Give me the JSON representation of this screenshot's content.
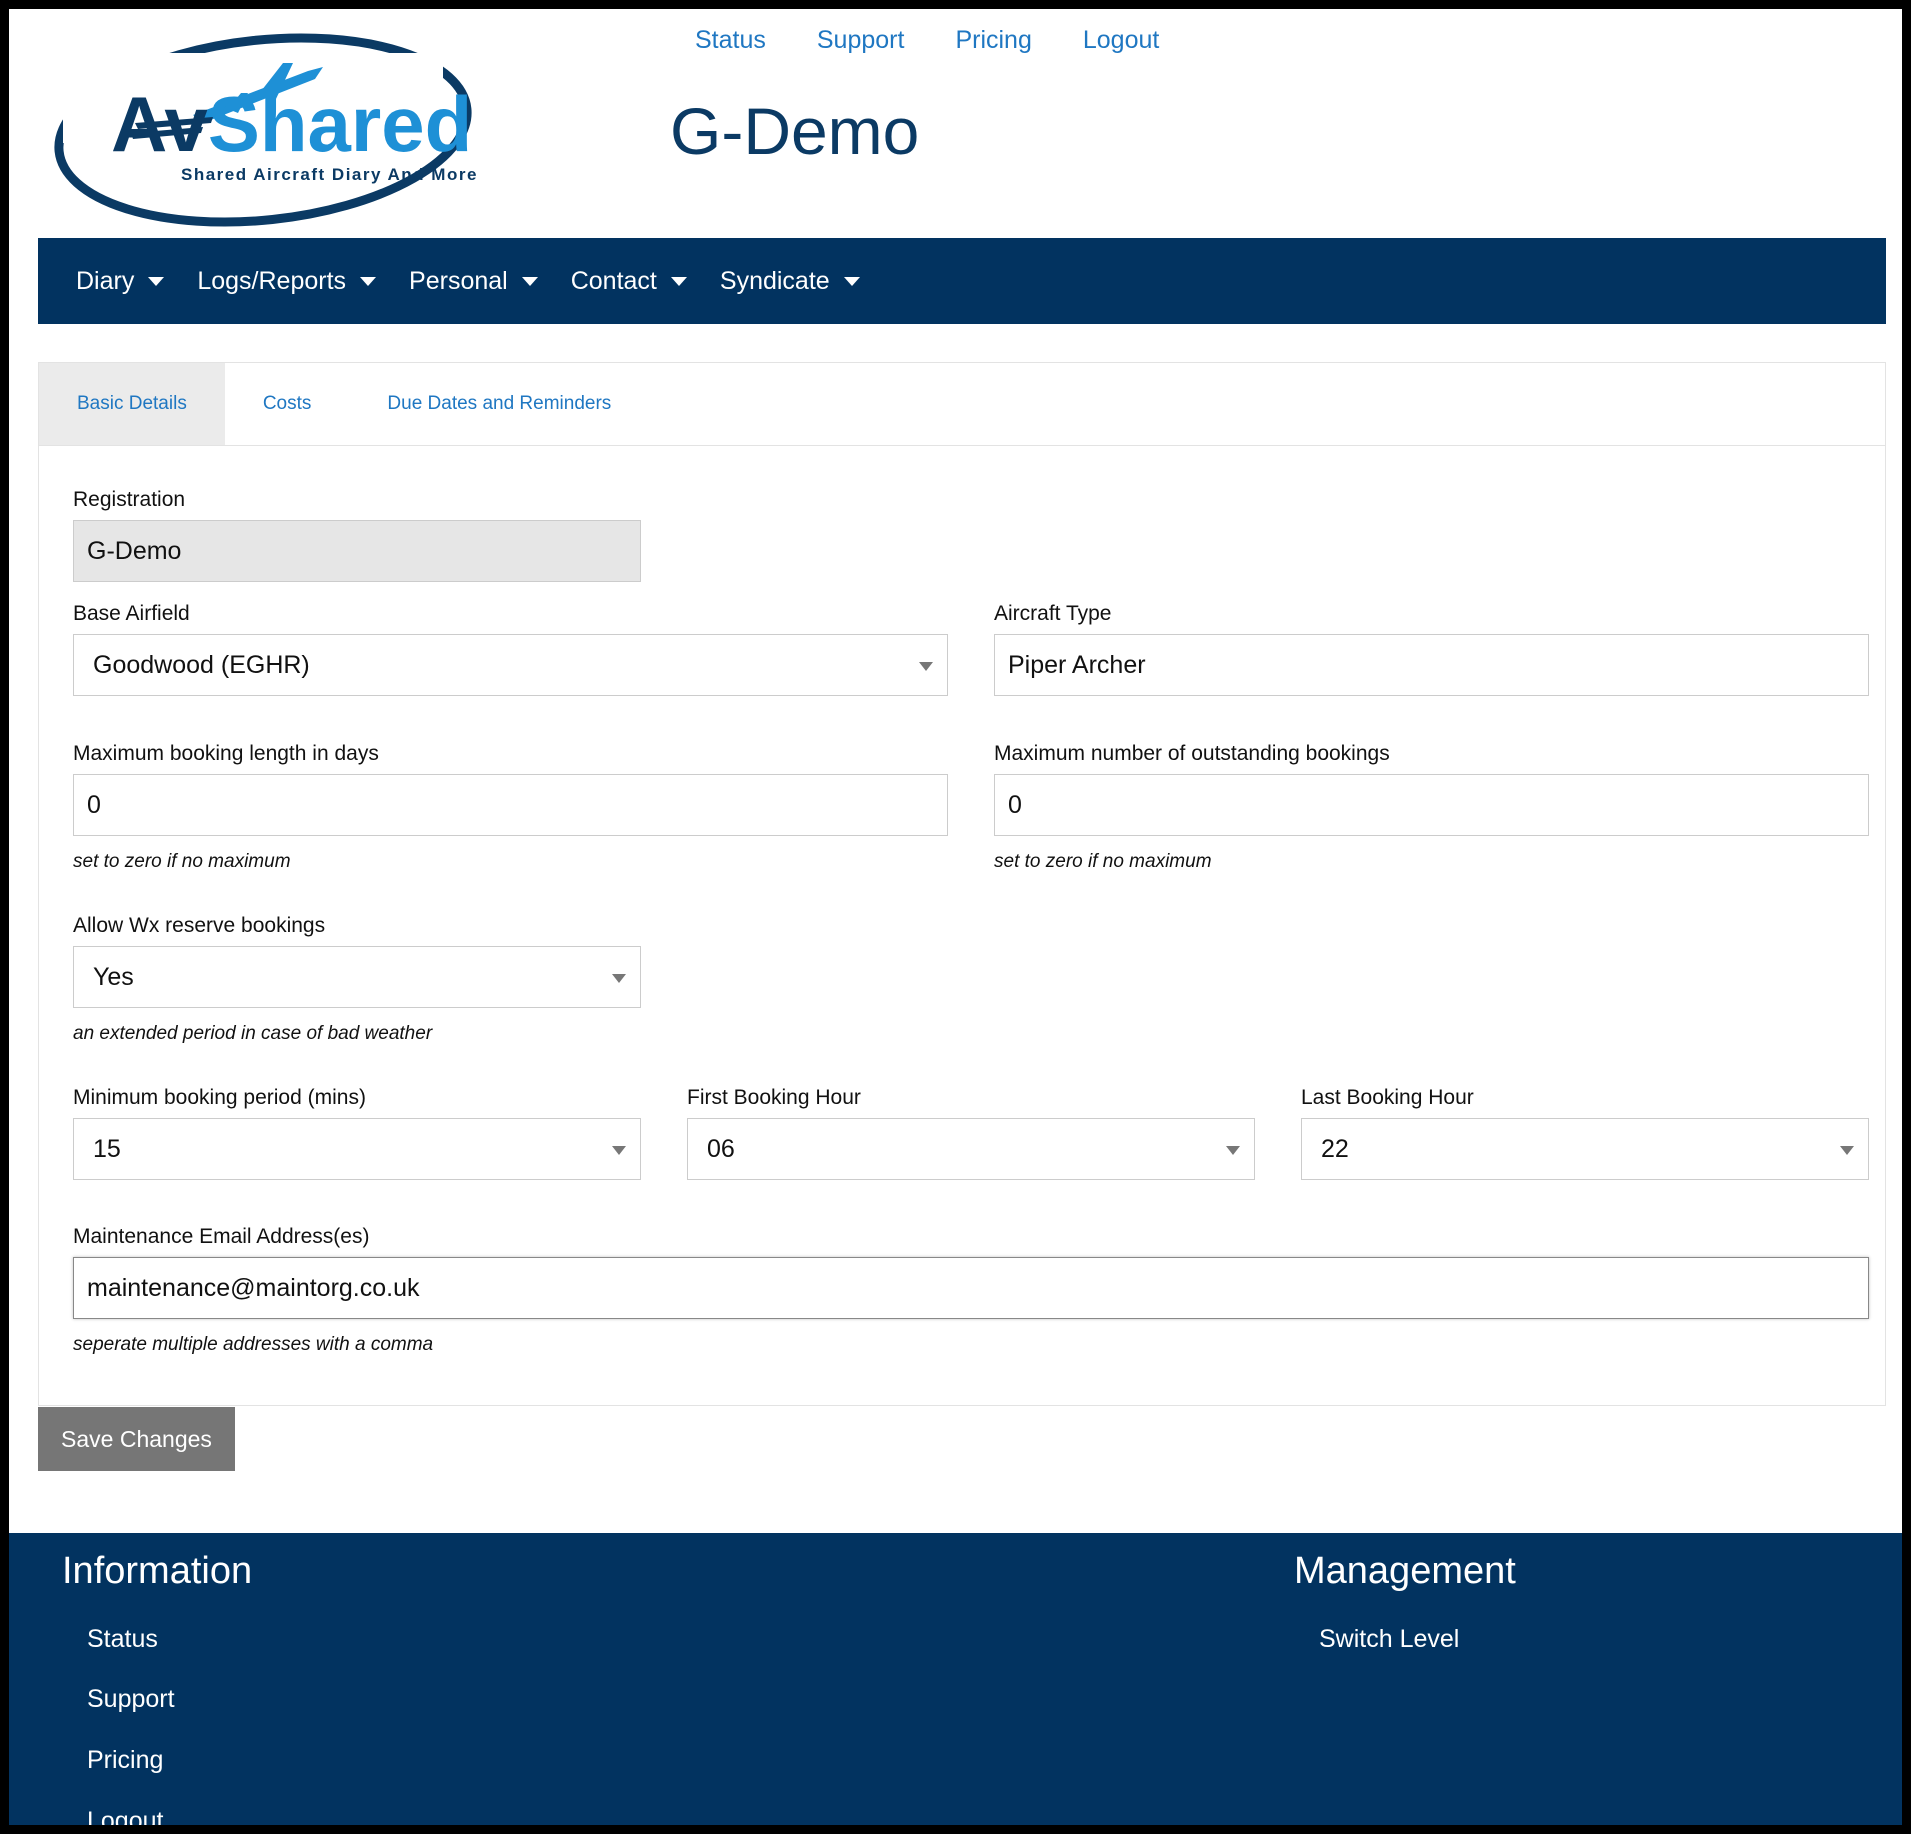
{
  "top_links": [
    "Status",
    "Support",
    "Pricing",
    "Logout"
  ],
  "logo": {
    "brand": "AvShared",
    "tagline": "Shared Aircraft Diary And More",
    "colors": {
      "navy": "#0b3a64",
      "blue": "#1e90d6"
    }
  },
  "site_title": "G-Demo",
  "nav": [
    "Diary",
    "Logs/Reports",
    "Personal",
    "Contact",
    "Syndicate"
  ],
  "tabs": [
    "Basic Details",
    "Costs",
    "Due Dates and Reminders"
  ],
  "form": {
    "registration": {
      "label": "Registration",
      "value": "G-Demo"
    },
    "base_airfield": {
      "label": "Base Airfield",
      "value": "Goodwood (EGHR)"
    },
    "aircraft_type": {
      "label": "Aircraft Type",
      "value": "Piper Archer"
    },
    "max_booking_days": {
      "label": "Maximum booking length in days",
      "value": "0",
      "help": "set to zero if no maximum"
    },
    "max_outstanding": {
      "label": "Maximum number of outstanding bookings",
      "value": "0",
      "help": "set to zero if no maximum"
    },
    "wx_reserve": {
      "label": "Allow Wx reserve bookings",
      "value": "Yes",
      "help": "an extended period in case of bad weather"
    },
    "min_period": {
      "label": "Minimum booking period (mins)",
      "value": "15"
    },
    "first_hour": {
      "label": "First Booking Hour",
      "value": "06"
    },
    "last_hour": {
      "label": "Last Booking Hour",
      "value": "22"
    },
    "maintenance_email": {
      "label": "Maintenance Email Address(es)",
      "value": "maintenance@maintorg.co.uk",
      "help": "seperate multiple addresses with a comma"
    }
  },
  "save_label": "Save Changes",
  "footer": {
    "information": {
      "heading": "Information",
      "links": [
        "Status",
        "Support",
        "Pricing",
        "Logout"
      ]
    },
    "management": {
      "heading": "Management",
      "links": [
        "Switch Level"
      ]
    }
  },
  "colors": {
    "navy": "#023360",
    "link": "#1f77c2",
    "button": "#767676"
  }
}
